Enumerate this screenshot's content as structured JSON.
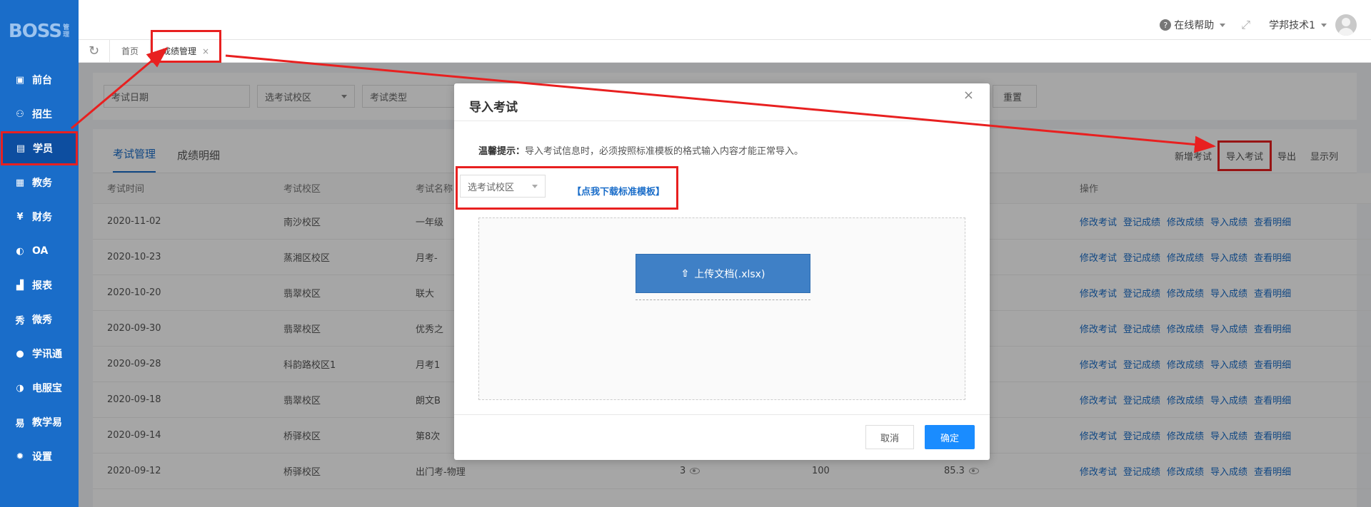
{
  "sidebar": {
    "logo": "BOSS",
    "logo_small": "管理",
    "items": [
      {
        "label": "前台",
        "icon": "calendar-icon"
      },
      {
        "label": "招生",
        "icon": "user-add-icon"
      },
      {
        "label": "学员",
        "icon": "student-card-icon"
      },
      {
        "label": "教务",
        "icon": "book-icon"
      },
      {
        "label": "财务",
        "icon": "yen-icon"
      },
      {
        "label": "OA",
        "icon": "oa-icon"
      },
      {
        "label": "报表",
        "icon": "bar-chart-icon"
      },
      {
        "label": "微秀",
        "icon": "weixiu-icon"
      },
      {
        "label": "学讯通",
        "icon": "message-icon"
      },
      {
        "label": "电服宝",
        "icon": "phone-icon"
      },
      {
        "label": "教学易",
        "icon": "teach-icon"
      },
      {
        "label": "设置",
        "icon": "gear-icon"
      }
    ]
  },
  "header": {
    "help": "在线帮助",
    "user": "学邦技术1"
  },
  "tabs": {
    "home": "首页",
    "current": "成绩管理",
    "close": "×"
  },
  "filters": {
    "date": "考试日期",
    "campus": "选考试校区",
    "type": "考试类型",
    "reset": "重置"
  },
  "panel": {
    "tabs": [
      "考试管理",
      "成绩明细"
    ],
    "actions": [
      "新增考试",
      "导入考试",
      "导出",
      "显示列"
    ],
    "columns": [
      "考试时间",
      "考试校区",
      "考试名称",
      "",
      "",
      "",
      "操作"
    ],
    "ops": [
      "修改考试",
      "登记成绩",
      "修改成绩",
      "导入成绩",
      "查看明细"
    ],
    "rows": [
      {
        "date": "2020-11-02",
        "campus": "南沙校区",
        "name": "一年级"
      },
      {
        "date": "2020-10-23",
        "campus": "蒸湘区校区",
        "name": "月考-"
      },
      {
        "date": "2020-10-20",
        "campus": "翡翠校区",
        "name": "联大"
      },
      {
        "date": "2020-09-30",
        "campus": "翡翠校区",
        "name": "优秀之"
      },
      {
        "date": "2020-09-28",
        "campus": "科韵路校区1",
        "name": "月考1"
      },
      {
        "date": "2020-09-18",
        "campus": "翡翠校区",
        "name": "朗文B"
      },
      {
        "date": "2020-09-14",
        "campus": "桥驿校区",
        "name": "第8次"
      },
      {
        "date": "2020-09-12",
        "campus": "桥驿校区",
        "name": "出门考-物理",
        "c4": "3",
        "c5": "100",
        "c6": "85.3"
      }
    ]
  },
  "modal": {
    "title": "导入考试",
    "close": "×",
    "tip_label": "温馨提示：",
    "tip_text": "导入考试信息时，必须按照标准模板的格式输入内容才能正常导入。",
    "campus_select": "选考试校区",
    "download_link": "【点我下载标准模板】",
    "upload_button": "上传文档(.xlsx)",
    "cancel": "取消",
    "ok": "确定"
  },
  "colors": {
    "sidebar": "#1a6dc9",
    "annotation": "#e82020",
    "primary": "#1a8cff"
  }
}
